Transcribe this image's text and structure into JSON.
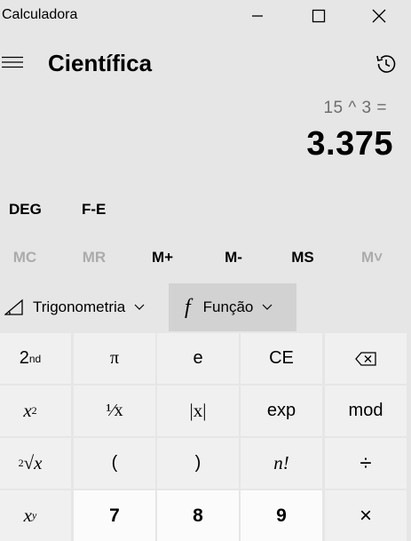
{
  "window": {
    "title": "Calculadora"
  },
  "header": {
    "mode": "Científica"
  },
  "display": {
    "expression": "15 ^ 3 =",
    "result": "3.375"
  },
  "angle": {
    "deg": "DEG",
    "fe": "F-E"
  },
  "memory": {
    "mc": "MC",
    "mr": "MR",
    "mplus": "M+",
    "mminus": "M-",
    "ms": "MS",
    "mlist": "M˅"
  },
  "functions": {
    "trig": "Trigonometria",
    "func": "Função",
    "func_icon_text": "f"
  },
  "keys": {
    "second": "2",
    "second_sup": "nd",
    "pi": "π",
    "e": "e",
    "ce": "CE",
    "square_base": "x",
    "square_exp": "2",
    "reciprocal": "¹⁄x",
    "abs": "|x|",
    "exp": "exp",
    "mod": "mod",
    "root_index": "2",
    "root_body": "√x",
    "open_paren": "(",
    "close_paren": ")",
    "factorial": "n!",
    "divide": "÷",
    "power_base": "x",
    "power_exp": "y",
    "seven": "7",
    "eight": "8",
    "nine": "9",
    "multiply": "×"
  }
}
